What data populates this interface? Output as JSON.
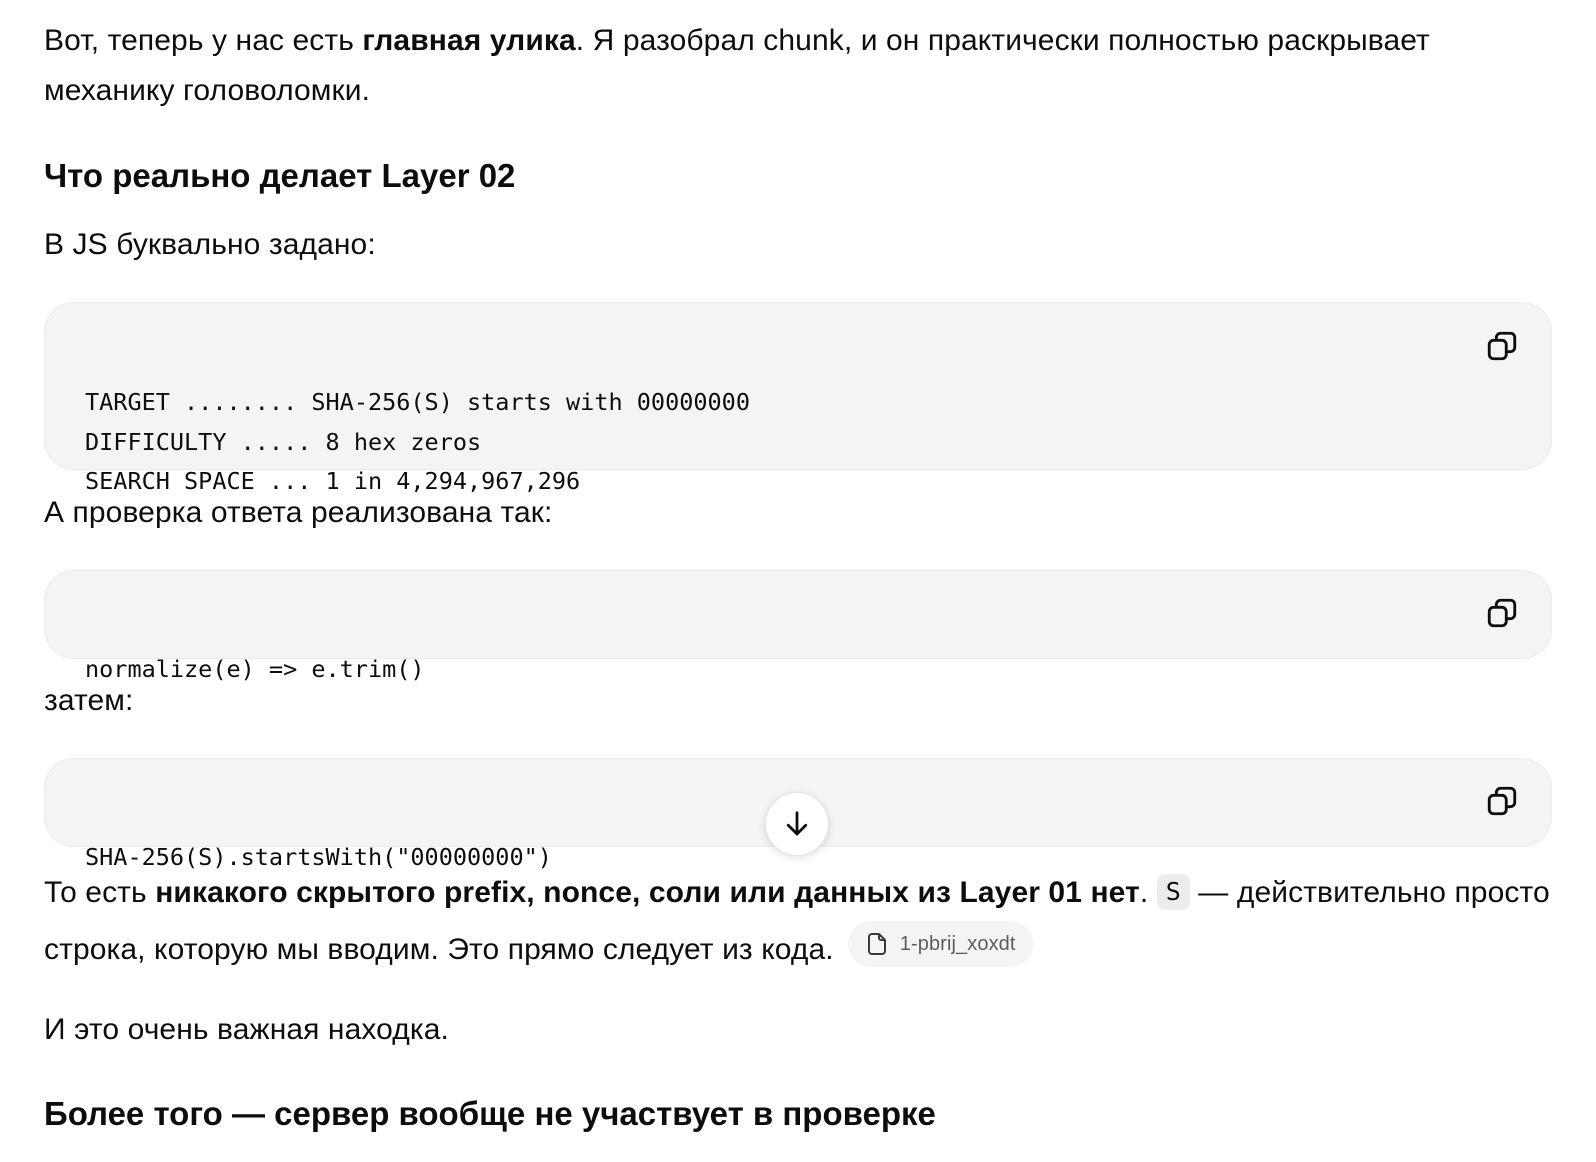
{
  "intro": {
    "part1": "Вот, теперь у нас есть ",
    "bold": "главная улика",
    "part2": ". Я разобрал chunk, и он практически полностью раскрывает механику головоломки."
  },
  "heading1": "Что реально делает Layer 02",
  "p_js": "В JS буквально задано:",
  "code1": {
    "lines": [
      "TARGET ........ SHA-256(S) starts with 00000000",
      "DIFFICULTY ..... 8 hex zeros",
      "SEARCH SPACE ... 1 in 4,294,967,296"
    ]
  },
  "p_check": "А проверка ответа реализована так:",
  "code2": {
    "lines": [
      "normalize(e) => e.trim()"
    ]
  },
  "p_then": "затем:",
  "code3": {
    "lines": [
      "SHA-256(S).startsWith(\"00000000\")"
    ]
  },
  "p_conclusion": {
    "part1": "То есть ",
    "bold": "никакого скрытого prefix, nonce, соли или данных из Layer 01 нет",
    "part2": ". ",
    "inline_code": "S",
    "part3": " — действительно просто строка, которую мы вводим. Это прямо следует из кода.",
    "source_label": "1-pbrij_xoxdt"
  },
  "p_important": "И это очень важная находка.",
  "heading2": "Более того — сервер вообще не участвует в проверке",
  "icons": {
    "copy": "copy-icon",
    "file": "file-icon",
    "scroll": "arrow-down-icon"
  }
}
